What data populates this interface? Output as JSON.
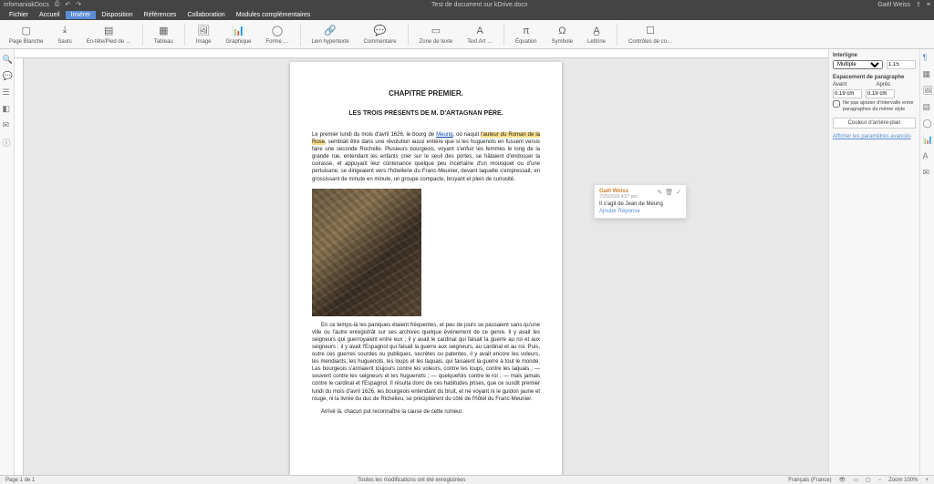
{
  "title": {
    "app": "infomaniakDocs",
    "doc": "Test de document sur kDrive.docx",
    "user": "Gaël Weiss"
  },
  "menu": {
    "fichier": "Fichier",
    "accueil": "Accueil",
    "inserer": "Insérer",
    "disposition": "Disposition",
    "references": "Références",
    "collaboration": "Collaboration",
    "modules": "Modules complémentaires"
  },
  "toolbar": {
    "page_blanche": "Page Blanche",
    "sauts": "Sauts",
    "entete": "En-tête/Pied de …",
    "tableau": "Tableau",
    "image": "Image",
    "graphique": "Graphique",
    "forme": "Forme …",
    "hyperlien": "Lien hypertexte",
    "commentaire": "Commentaire",
    "zone_texte": "Zone de texte",
    "text_art": "Text Art …",
    "equation": "Équation",
    "symbole": "Symbole",
    "lettrine": "Lettrine",
    "controles": "Contrôles de co…"
  },
  "doc": {
    "chapter": "CHAPITRE PREMIER.",
    "subtitle": "LES TROIS PRÉSENTS DE M. D'ARTAGNAN PÈRE.",
    "p1a": "Le premier lundi du mois d'avril 1626, le bourg de ",
    "p1_link": "Meung",
    "p1b": ", où naquit ",
    "p1_hl": "l'auteur du Roman de la Rose",
    "p1c": ", semblait être dans une révolution aussi entière que si les huguenots en fussent venus faire une seconde Rochelle. Plusieurs bourgeois, voyant s'enfuir les femmes le long de la grande rue, entendant les enfants crier sur le seuil des portes, se hâtaient d'endosser la cuirasse, et appuyant leur contenance quelque peu incertaine d'un mousquet ou d'une pertuisane, se dirigeaient vers l'hôtellerie du Franc-Meunier, devant laquelle s'empressait, en grossissant de minute en minute, un groupe compacte, bruyant et plein de curiosité.",
    "p2": "En ce temps-là les paniques étaient fréquentes, et peu de jours se passaient sans qu'une ville ou l'autre enregistrât sur ses archives quelque événement de ce genre. Il y avait les seigneurs qui guerroyaient entre eux ; il y avait le cardinal qui faisait la guerre au roi et aux seigneurs ; il y avait l'Espagnol qui faisait la guerre aux seigneurs, au cardinal et au roi. Puis, outre ces guerres sourdes ou publiques, secrètes ou patentes, il y avait encore les voleurs, les mendiants, les huguenots, les loups et les laquais, qui faisaient la guerre à tout le monde. Les bourgeois s'armaient toujours contre les voleurs, contre les loups, contre les laquais ; — souvent contre les seigneurs et les huguenots ; — quelquefois contre le roi ; — mais jamais contre le cardinal et l'Espagnol. Il résulta donc de ces habitudes prises, que ce susdit premier lundi du mois d'avril 1626, les bourgeois entendant du bruit, et ne voyant ni le guidon jaune et rouge, ni la livrée du duc de Richelieu, se précipitèrent du côté de l'hôtel du Franc-Meunier.",
    "p3": "Arrivé là, chacun put reconnaître la cause de cette rumeur."
  },
  "comment": {
    "author": "Gaël Weiss",
    "date": "7/25/2019 4:57 pm",
    "text": "Il s'agit de Jean de Meung",
    "reply": "Ajouter Réponse"
  },
  "panel": {
    "interligne": "Interligne",
    "interligne_val": "1.15",
    "espacement": "Espacement de paragraphe",
    "avant": "Avant",
    "apres": "Après",
    "avant_val": "0.19 cm",
    "apres_val": "0.19 cm",
    "chk": "Ne pas ajouter d'intervalle entre paragraphes du même style",
    "couleur": "Couleur d'arrière-plan",
    "avance": "Afficher les paramètres avancés"
  },
  "status": {
    "page": "Page 1 de 1",
    "saved": "Toutes les modifications ont été enregistrées",
    "lang": "Français (France)",
    "zoom": "Zoom 100%"
  }
}
